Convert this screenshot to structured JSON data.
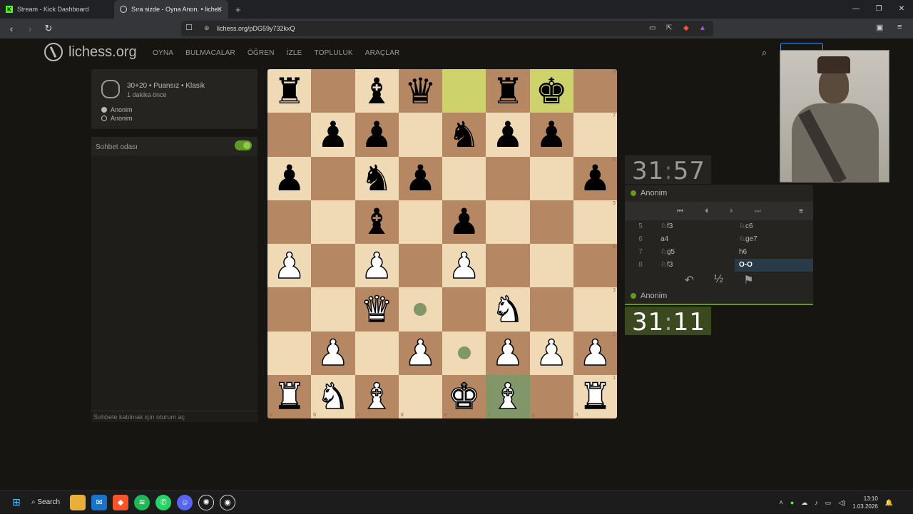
{
  "browser": {
    "tabs": [
      {
        "label": "Stream - Kick Dashboard",
        "active": false
      },
      {
        "label": "Sıra sizde - Oyna Anon. • liches",
        "active": true
      }
    ],
    "url": "lichess.org/pDG59y732kxQ"
  },
  "site": {
    "logo": "lichess.org",
    "menu": [
      "OYNA",
      "BULMACALAR",
      "ÖĞREN",
      "İZLE",
      "TOPLULUK",
      "ARAÇLAR"
    ]
  },
  "game": {
    "title": "30+20 • Puansız • Klasik",
    "subtitle": "1 dakika önce",
    "white": "Anonim",
    "black": "Anonim"
  },
  "chat": {
    "header": "Sohbet odası",
    "footer": "Sohbete katılmak için oturum aç"
  },
  "board": {
    "ranks": [
      [
        "r",
        "",
        "b",
        "q",
        "",
        "r",
        "k",
        ""
      ],
      [
        "",
        "p",
        "p",
        "",
        "n",
        "p",
        "p",
        ""
      ],
      [
        "p",
        "",
        "n",
        "p",
        "",
        "",
        "",
        "p"
      ],
      [
        "",
        "",
        "b",
        "",
        "p",
        "",
        "",
        ""
      ],
      [
        "P",
        "",
        "P",
        "",
        "P",
        "",
        "",
        ""
      ],
      [
        "",
        "",
        "Q",
        "",
        "",
        "N",
        "",
        ""
      ],
      [
        "",
        "P",
        "",
        "P",
        "",
        "P",
        "P",
        "P"
      ],
      [
        "R",
        "N",
        "B",
        "",
        "K",
        "B",
        "",
        "R"
      ]
    ],
    "files": [
      "a",
      "b",
      "c",
      "d",
      "e",
      "f",
      "g",
      "h"
    ],
    "rank_labels": [
      "8",
      "7",
      "6",
      "5",
      "4",
      "3",
      "2",
      "1"
    ]
  },
  "clocks": {
    "top": {
      "min": "31",
      "sec": "57"
    },
    "bottom": {
      "min": "31",
      "sec": "11"
    }
  },
  "players": {
    "top": "Anonim",
    "bottom": "Anonim"
  },
  "moves": [
    {
      "n": "5",
      "w": "♘f3",
      "b": "♘c6"
    },
    {
      "n": "6",
      "w": "a4",
      "b": "♘ge7"
    },
    {
      "n": "7",
      "w": "♘g5",
      "b": "h6"
    },
    {
      "n": "8",
      "w": "♘f3",
      "b": "O-O"
    }
  ],
  "actions": {
    "takeback": "↶",
    "draw": "½",
    "resign": "⚑"
  },
  "taskbar": {
    "search": "Search",
    "time": "13:10",
    "date": "1.03.2026"
  }
}
